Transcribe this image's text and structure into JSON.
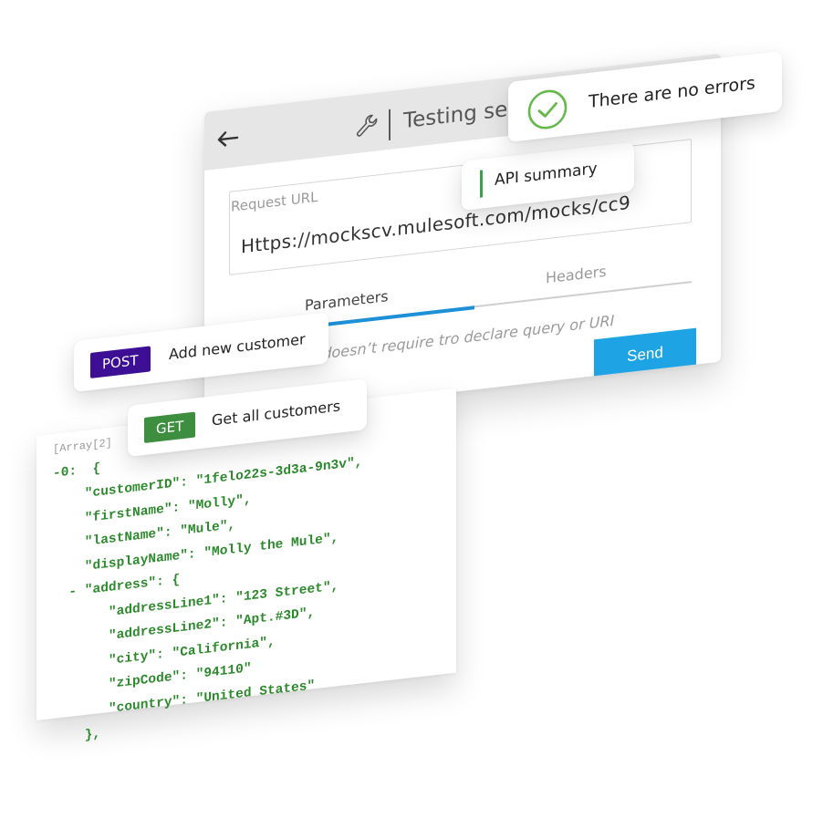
{
  "panel": {
    "title": "Testing se",
    "request_url_label": "Request URL",
    "request_url_value": "Https://mockscv.mulesoft.com/mocks/cc9",
    "tabs": [
      {
        "label": "Parameters"
      },
      {
        "label": "Headers"
      }
    ],
    "hint": "t doesn’t require tro declare query or URI",
    "send_label": "Send"
  },
  "status_card": {
    "text": "There are no errors"
  },
  "summary_card": {
    "text": "API summary"
  },
  "endpoints": [
    {
      "method": "POST",
      "label": "Add new customer",
      "color": "#3d0f95"
    },
    {
      "method": "GET",
      "label": "Get all customers",
      "color": "#3d8f3f"
    }
  ],
  "colors": {
    "send_button": "#1ea3e4",
    "tab_indicator": "#1e90d8",
    "success": "#66b84a",
    "json_text": "#2c8a2c"
  },
  "json_preview": {
    "array_label": "[Array[2]",
    "lines": [
      "-0:  {",
      "    \"customerID\": \"1felo22s-3d3a-9n3v\",",
      "    \"firstName\": \"Molly\",",
      "    \"lastName\": \"Mule\",",
      "    \"displayName\": \"Molly the Mule\",",
      "  - \"address\": {",
      "       \"addressLine1\": \"123 Street\",",
      "       \"addressLine2\": \"Apt.#3D\",",
      "       \"city\": \"California\",",
      "       \"zipCode\": \"94110\"",
      "       \"country\": \"United States\"",
      "    },"
    ]
  }
}
